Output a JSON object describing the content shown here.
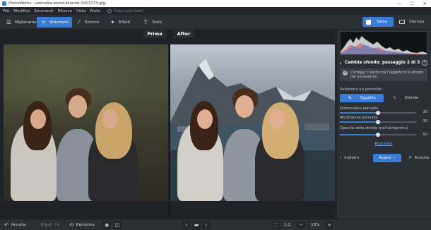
{
  "window": {
    "title": "PhotoWorks - adorable-blond-blonde-1913773.jpg",
    "controls": [
      "—",
      "☐",
      "✕"
    ]
  },
  "menu": {
    "items": [
      "File",
      "Modifica",
      "Strumenti",
      "Ritocco",
      "Vista",
      "Aiuto"
    ],
    "search_placeholder": "Cosa vuoi fare?"
  },
  "toolbar": {
    "tabs": [
      {
        "label": "Miglioramento",
        "icon": "sliders-icon",
        "active": false
      },
      {
        "label": "Strumenti",
        "icon": "crop-icon",
        "active": true
      },
      {
        "label": "Ritocco",
        "icon": "brush-icon",
        "active": false
      },
      {
        "label": "Effetti",
        "icon": "wand-icon",
        "active": false
      },
      {
        "label": "Testo",
        "icon": "text-icon",
        "active": false
      }
    ],
    "save_label": "Salva",
    "print_label": "Stampa"
  },
  "canvas": {
    "before_label": "Prima",
    "after_label": "After"
  },
  "panel": {
    "title": "Cambia sfondo: passaggio 2 di 3",
    "hint": "Correggi il bordo tra l'oggetto e lo sfondo (se necessario).",
    "brush_title": "Seleziona un pennello:",
    "brush_object": "Oggetto",
    "brush_background": "Sfondo",
    "brush_size_label": "Dimensione pennello",
    "brush_size_value": "30",
    "brush_size_level": 0.5,
    "brush_width_label": "Morbidezza pennello",
    "brush_width_value": "30",
    "brush_width_level": 0.5,
    "opacity_label": "Opacità dello sfondo (nell'anteprima)",
    "opacity_value": "50",
    "opacity_level": 0.5,
    "reset_label": "Ripristina",
    "prev_label": "Indietro",
    "next_label": "Avanti",
    "cancel_label": "Annulla",
    "accent": "#3a7bd5"
  },
  "bottom": {
    "undo_label": "Annulla",
    "redo_label": "Ripeti",
    "restore_label": "Ripristina",
    "zoom_ratio": "1:1",
    "zoom_value": "18%",
    "zoom_level": 0.12
  }
}
